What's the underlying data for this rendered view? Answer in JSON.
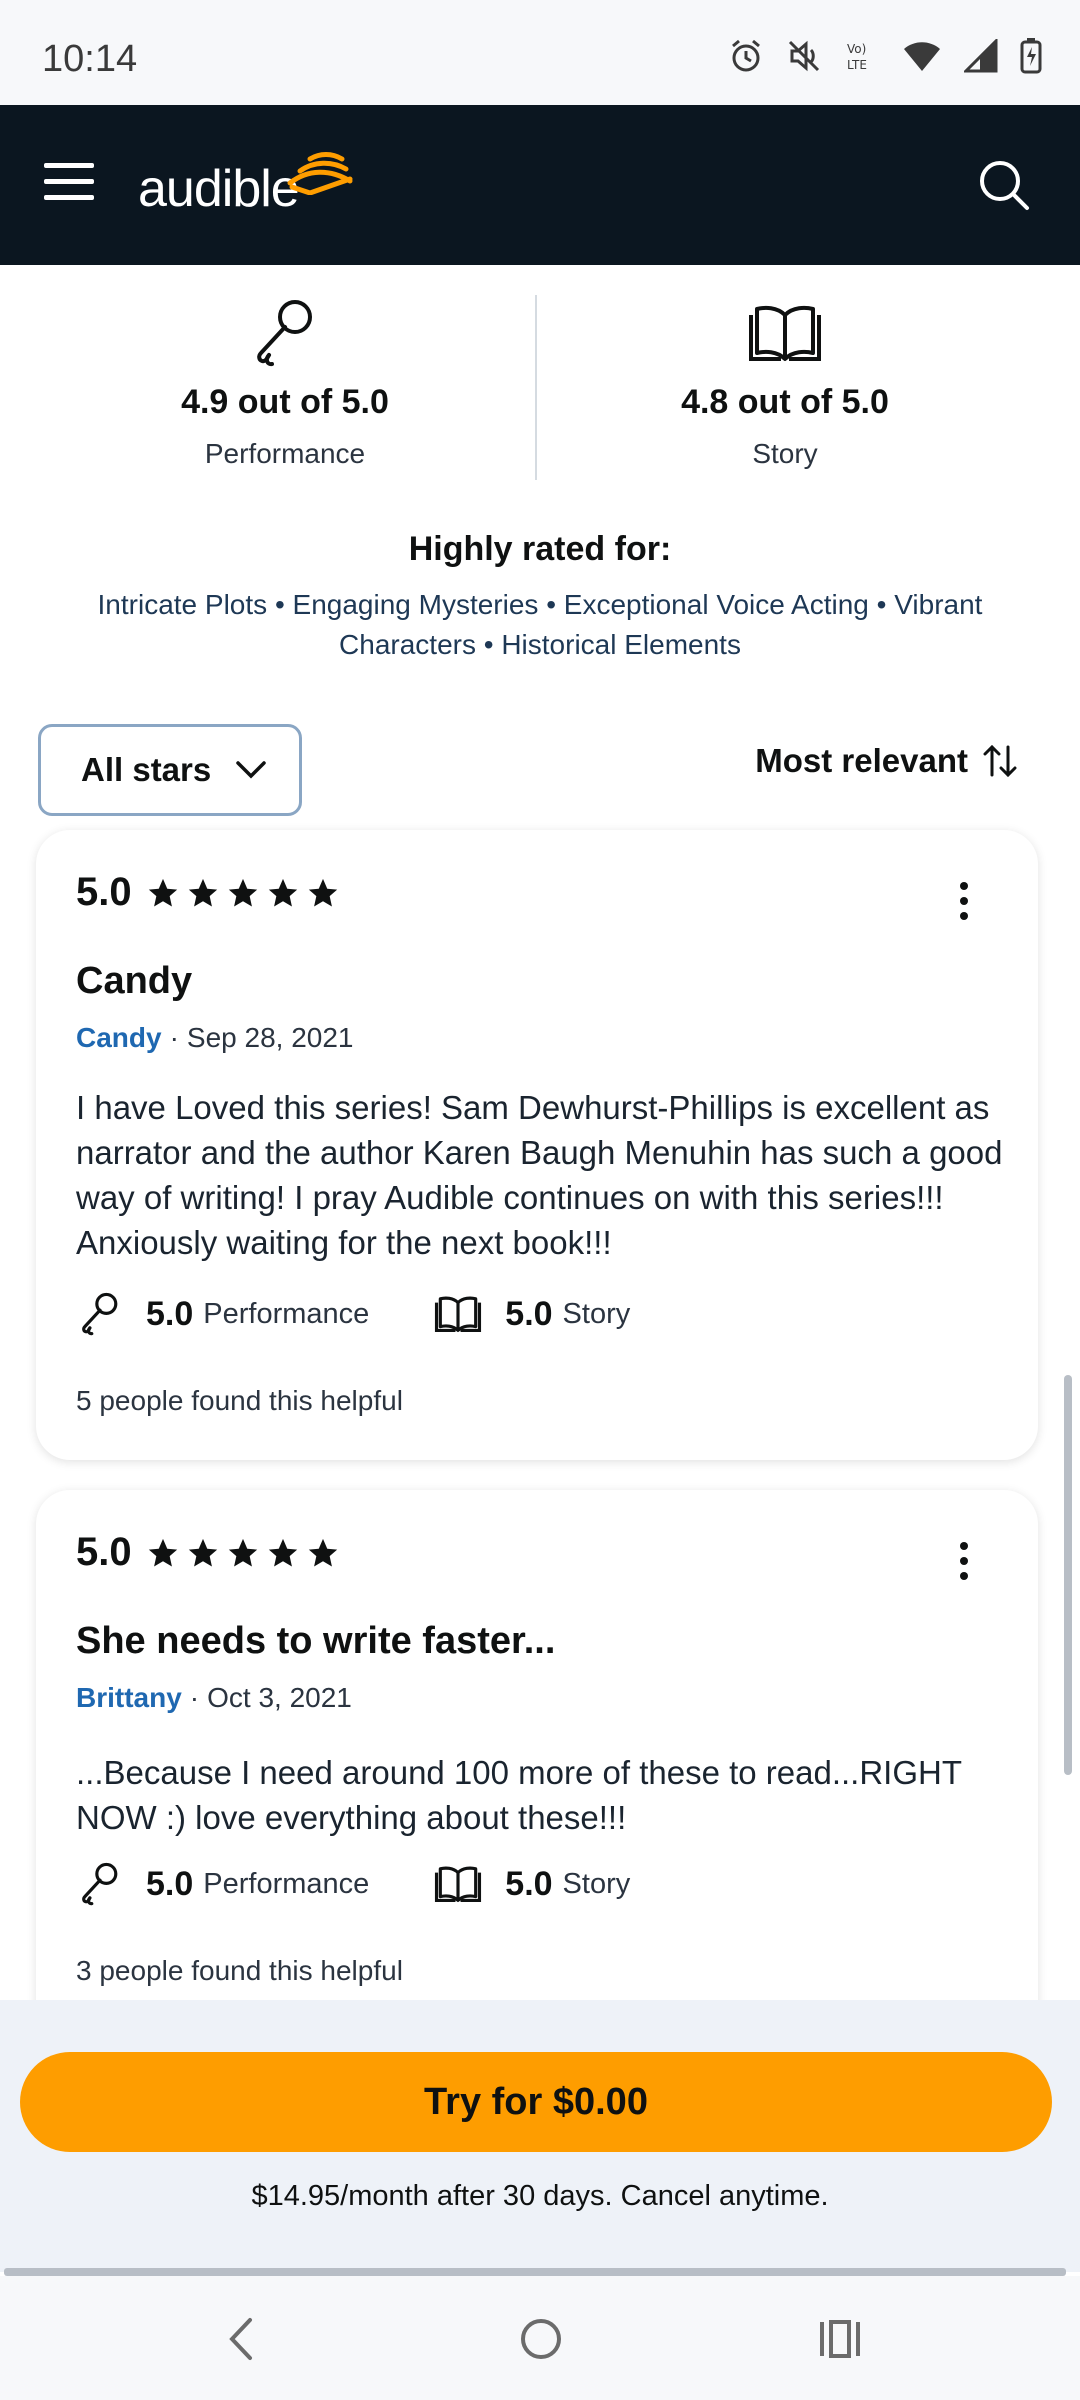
{
  "status_bar": {
    "time": "10:14",
    "icons": [
      "alarm-icon",
      "mute-icon",
      "volte-icon",
      "wifi-icon",
      "signal-icon",
      "battery-icon"
    ]
  },
  "header": {
    "app_name": "audible",
    "menu_icon": "hamburger-menu-icon",
    "search_icon": "search-icon",
    "background": "#0b1620",
    "logo_accent": "#fe9d00"
  },
  "summary": {
    "performance": {
      "score": "4.9 out of 5.0",
      "label": "Performance",
      "icon": "microphone-icon"
    },
    "story": {
      "score": "4.8 out of 5.0",
      "label": "Story",
      "icon": "book-icon"
    }
  },
  "highly_rated": {
    "title": "Highly rated for:",
    "tags_line1": "Intricate Plots • Engaging Mysteries • Exceptional Voice Acting • Vibrant",
    "tags_line2": "Characters • Historical Elements"
  },
  "filters": {
    "stars_filter": "All stars",
    "sort_label": "Most relevant"
  },
  "reviews": [
    {
      "rating": "5.0",
      "stars": 5,
      "title": "Candy",
      "author": "Candy",
      "date": "Sep 28, 2021",
      "body": "I have Loved this series! Sam Dewhurst-Phillips is excellent as narrator and the author Karen Baugh Menuhin has such a good way of writing! I pray Audible continues on with this series!!! Anxiously waiting for the next book!!!",
      "performance_score": "5.0",
      "performance_label": "Performance",
      "story_score": "5.0",
      "story_label": "Story",
      "helpful": "5 people found this helpful"
    },
    {
      "rating": "5.0",
      "stars": 5,
      "title": "She needs to write faster...",
      "author": "Brittany",
      "date": "Oct 3, 2021",
      "body": "...Because I need around 100 more of these to read...RIGHT NOW :) love everything about these!!!",
      "performance_score": "5.0",
      "performance_label": "Performance",
      "story_score": "5.0",
      "story_label": "Story",
      "helpful": "3 people found this helpful"
    }
  ],
  "cta": {
    "button_label": "Try for $0.00",
    "note": "$14.95/month after 30 days. Cancel anytime.",
    "button_color": "#fe9d00"
  },
  "nav_bar": {
    "back_icon": "back-chevron-icon",
    "home_icon": "home-circle-icon",
    "recents_icon": "recents-icon"
  }
}
